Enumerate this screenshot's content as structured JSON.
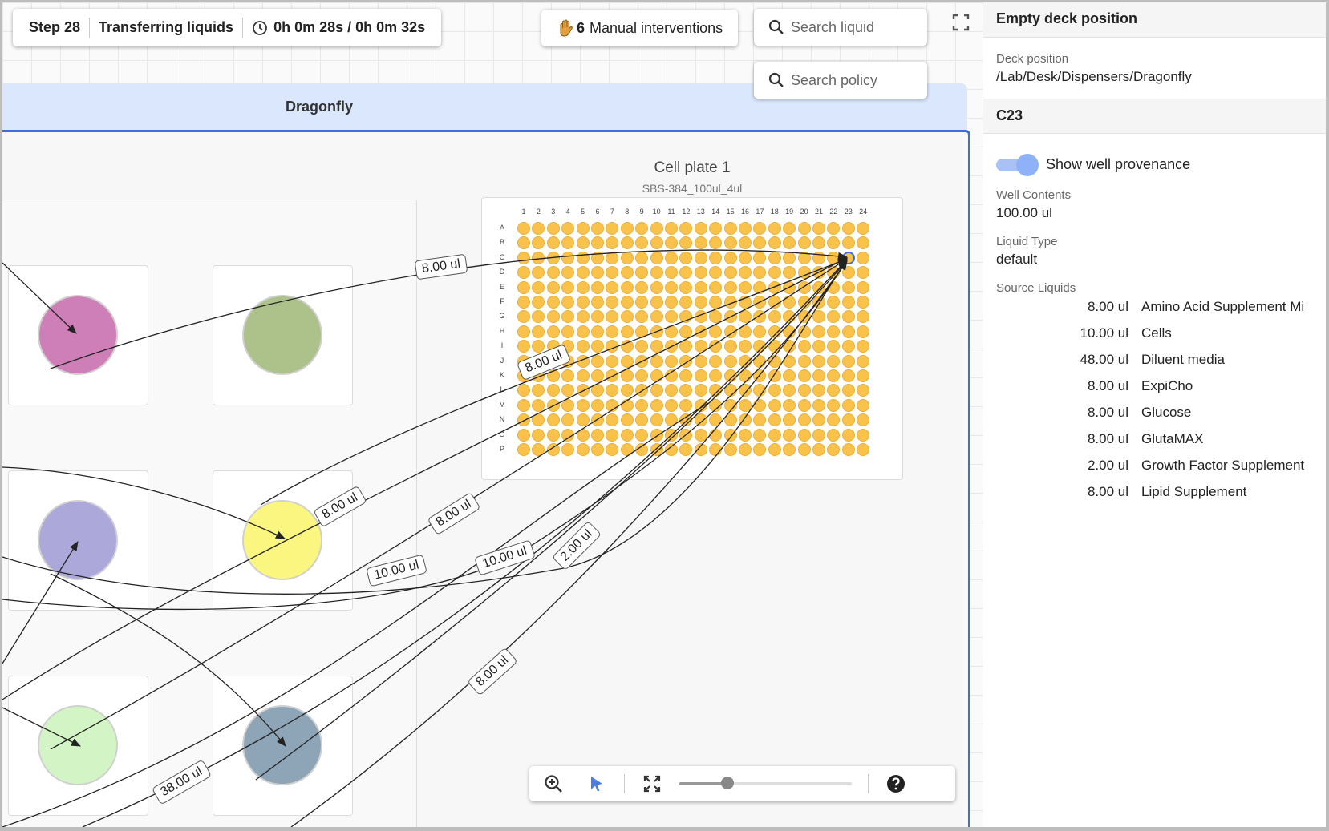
{
  "status": {
    "step": "Step 28",
    "action": "Transferring liquids",
    "elapsed": "0h 0m 28s / 0h 0m 32s"
  },
  "interventions": {
    "count": "6",
    "label": "Manual interventions"
  },
  "search": {
    "liquid_placeholder": "Search liquid",
    "policy_placeholder": "Search policy"
  },
  "deck": {
    "title": "Dragonfly"
  },
  "plate": {
    "name": "Cell plate 1",
    "type": "SBS-384_100ul_4ul",
    "columns": [
      "1",
      "2",
      "3",
      "4",
      "5",
      "6",
      "7",
      "8",
      "9",
      "10",
      "11",
      "12",
      "13",
      "14",
      "15",
      "16",
      "17",
      "18",
      "19",
      "20",
      "21",
      "22",
      "23",
      "24"
    ],
    "rows": [
      "A",
      "B",
      "C",
      "D",
      "E",
      "F",
      "G",
      "H",
      "I",
      "J",
      "K",
      "L",
      "M",
      "N",
      "O",
      "P"
    ],
    "selected_well": "C23",
    "well_color": "#f9c24a"
  },
  "reservoirs": [
    {
      "color": "#cf7fb8"
    },
    {
      "color": "#adc18a"
    },
    {
      "color": "#ada8da"
    },
    {
      "color": "#fbf67f"
    },
    {
      "color": "#d3f5c6"
    },
    {
      "color": "#8da5b7"
    }
  ],
  "transfers": [
    "8.00 ul",
    "8.00 ul",
    "8.00 ul",
    "8.00 ul",
    "10.00 ul",
    "10.00 ul",
    "2.00 ul",
    "8.00 ul",
    "38.00 ul"
  ],
  "zoom": {
    "level": 0.28
  },
  "side_panel": {
    "header": "Empty deck position",
    "deck_position_label": "Deck position",
    "deck_position_value": "/Lab/Desk/Dispensers/Dragonfly",
    "well_header": "C23",
    "toggle_label": "Show well provenance",
    "toggle_on": true,
    "well_contents_label": "Well Contents",
    "well_contents_value": "100.00 ul",
    "liquid_type_label": "Liquid Type",
    "liquid_type_value": "default",
    "source_liquids_label": "Source Liquids",
    "source_liquids": [
      {
        "amount": "8.00 ul",
        "name": "Amino Acid Supplement Mi"
      },
      {
        "amount": "10.00 ul",
        "name": "Cells"
      },
      {
        "amount": "48.00 ul",
        "name": "Diluent media"
      },
      {
        "amount": "8.00 ul",
        "name": "ExpiCho"
      },
      {
        "amount": "8.00 ul",
        "name": "Glucose"
      },
      {
        "amount": "8.00 ul",
        "name": "GlutaMAX"
      },
      {
        "amount": "2.00 ul",
        "name": "Growth Factor Supplement"
      },
      {
        "amount": "8.00 ul",
        "name": "Lipid Supplement"
      }
    ]
  }
}
